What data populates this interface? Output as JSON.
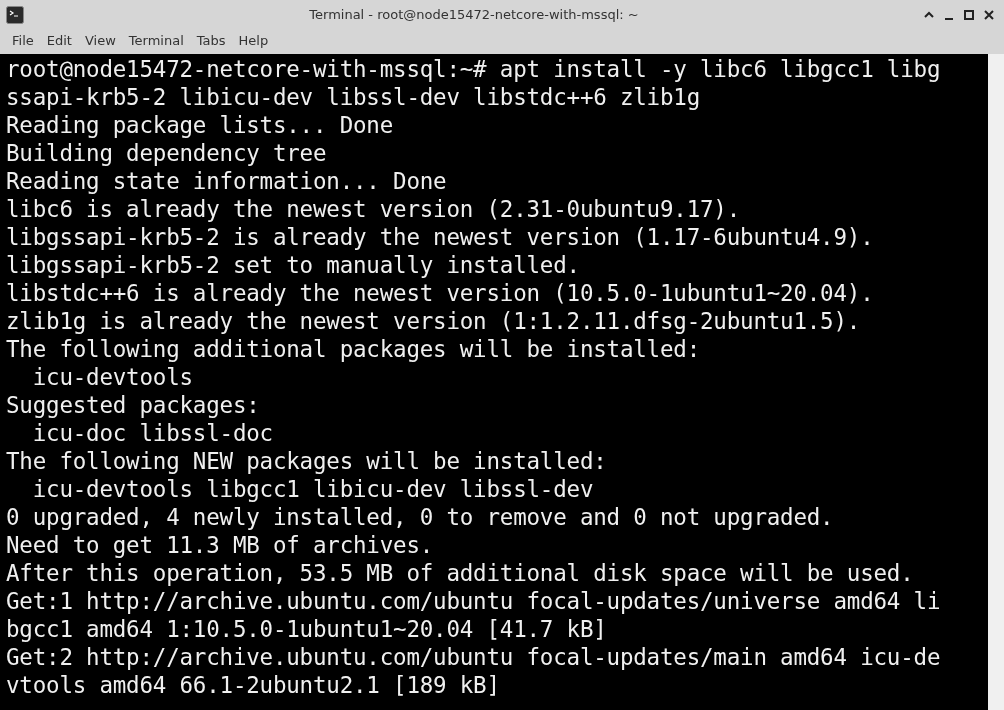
{
  "window": {
    "title": "Terminal - root@node15472-netcore-with-mssql: ~"
  },
  "menu": [
    "File",
    "Edit",
    "View",
    "Terminal",
    "Tabs",
    "Help"
  ],
  "terminal": {
    "lines": [
      "root@node15472-netcore-with-mssql:~# apt install -y libc6 libgcc1 libg",
      "ssapi-krb5-2 libicu-dev libssl-dev libstdc++6 zlib1g",
      "Reading package lists... Done",
      "Building dependency tree",
      "Reading state information... Done",
      "libc6 is already the newest version (2.31-0ubuntu9.17).",
      "libgssapi-krb5-2 is already the newest version (1.17-6ubuntu4.9).",
      "libgssapi-krb5-2 set to manually installed.",
      "libstdc++6 is already the newest version (10.5.0-1ubuntu1~20.04).",
      "zlib1g is already the newest version (1:1.2.11.dfsg-2ubuntu1.5).",
      "The following additional packages will be installed:",
      "  icu-devtools",
      "Suggested packages:",
      "  icu-doc libssl-doc",
      "The following NEW packages will be installed:",
      "  icu-devtools libgcc1 libicu-dev libssl-dev",
      "0 upgraded, 4 newly installed, 0 to remove and 0 not upgraded.",
      "Need to get 11.3 MB of archives.",
      "After this operation, 53.5 MB of additional disk space will be used.",
      "Get:1 http://archive.ubuntu.com/ubuntu focal-updates/universe amd64 li",
      "bgcc1 amd64 1:10.5.0-1ubuntu1~20.04 [41.7 kB]",
      "Get:2 http://archive.ubuntu.com/ubuntu focal-updates/main amd64 icu-de",
      "vtools amd64 66.1-2ubuntu2.1 [189 kB]"
    ]
  }
}
